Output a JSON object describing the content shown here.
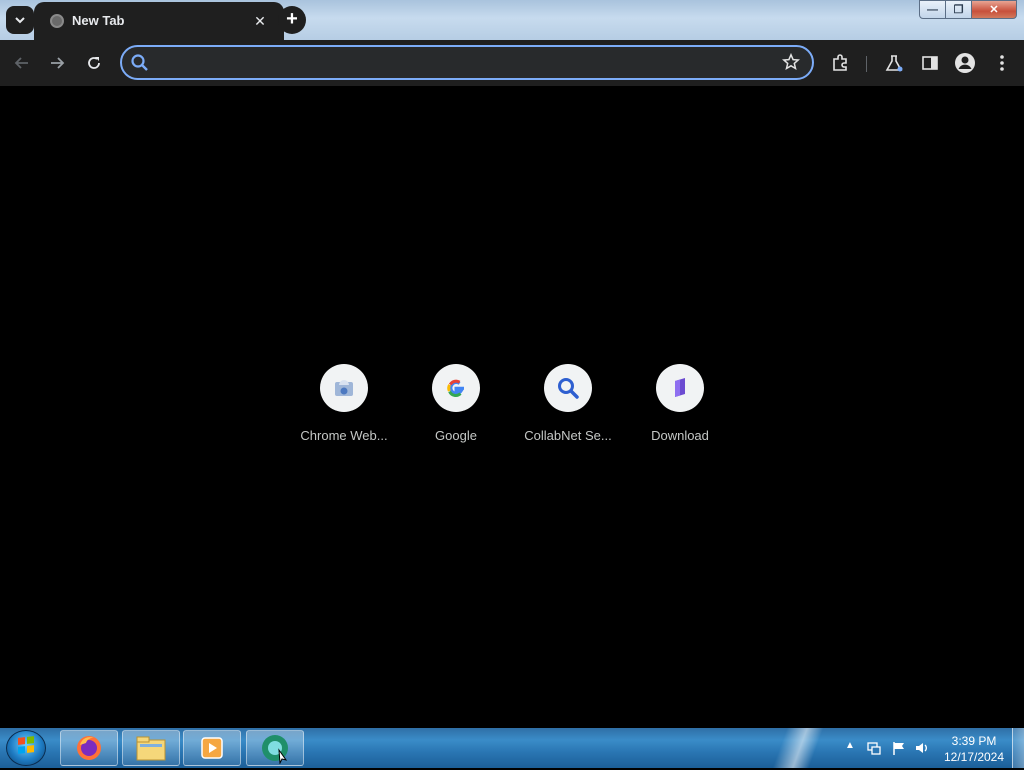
{
  "browser": {
    "tab": {
      "title": "New Tab"
    },
    "new_tab_symbol": "+",
    "close_tab_symbol": "✕",
    "window_controls": {
      "minimize": "—",
      "maximize": "❐",
      "close": "✕"
    },
    "omnibox": {
      "value": "",
      "placeholder": ""
    },
    "toolbar_icons": [
      "back-arrow-icon",
      "forward-arrow-icon",
      "reload-icon",
      "star-icon",
      "extensions-icon",
      "labs-icon",
      "side-panel-icon",
      "profile-icon",
      "more-menu-icon"
    ]
  },
  "shortcuts": [
    {
      "label": "Chrome Web...",
      "icon": "chrome-web-store-icon"
    },
    {
      "label": "Google",
      "icon": "google-g-icon"
    },
    {
      "label": "CollabNet Se...",
      "icon": "collabnet-search-icon"
    },
    {
      "label": "Download",
      "icon": "download-icon"
    }
  ],
  "taskbar": {
    "apps": [
      "firefox-icon",
      "file-explorer-icon",
      "media-player-icon",
      "browser-app-icon"
    ],
    "clock": {
      "time": "3:39 PM",
      "date": "12/17/2024"
    },
    "tray_icons": [
      "network-icon",
      "action-center-flag-icon",
      "volume-icon"
    ]
  },
  "colors": {
    "accent": "#7cacf8",
    "page_background": "#000000",
    "toolbar": "#1f1f1f"
  }
}
